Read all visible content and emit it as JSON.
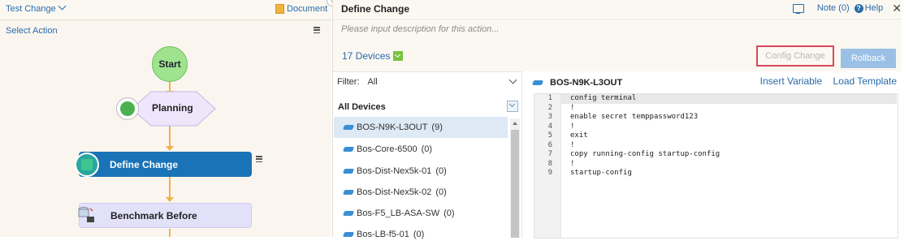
{
  "left_panel": {
    "title": "Test Change",
    "document_link": "Document",
    "select_action": "Select Action",
    "flow": {
      "start": "Start",
      "planning": "Planning",
      "define_change": "Define Change",
      "benchmark_before": "Benchmark Before"
    }
  },
  "right_panel": {
    "title": "Define Change",
    "note": "Note (0)",
    "help": "Help",
    "description_placeholder": "Please input description for this action...",
    "device_count": "17 Devices",
    "config_change_button": "Config Change",
    "rollback_button": "Rollback"
  },
  "device_list": {
    "filter_label": "Filter:",
    "filter_value": "All",
    "header": "All Devices",
    "devices": [
      {
        "name": "BOS-N9K-L3OUT",
        "count": "(9)",
        "selected": true
      },
      {
        "name": "Bos-Core-6500",
        "count": "(0)"
      },
      {
        "name": "Bos-Dist-Nex5k-01",
        "count": "(0)"
      },
      {
        "name": "Bos-Dist-Nex5k-02",
        "count": "(0)"
      },
      {
        "name": "Bos-F5_LB-ASA-SW",
        "count": "(0)"
      },
      {
        "name": "Bos-LB-f5-01",
        "count": "(0)"
      }
    ]
  },
  "editor": {
    "device": "BOS-N9K-L3OUT",
    "insert_variable": "Insert Variable",
    "load_template": "Load Template",
    "lines": [
      {
        "n": "1",
        "text": "config terminal"
      },
      {
        "n": "2",
        "text": "!"
      },
      {
        "n": "3",
        "text": "enable secret temppassword123"
      },
      {
        "n": "4",
        "text": "!"
      },
      {
        "n": "5",
        "text": "exit"
      },
      {
        "n": "6",
        "text": "!"
      },
      {
        "n": "7",
        "text": "copy running-config startup-config"
      },
      {
        "n": "8",
        "text": "!"
      },
      {
        "n": "9",
        "text": "startup-config"
      }
    ]
  },
  "colors": {
    "accent_blue": "#2a6aa8",
    "selected_node": "#1a73b6",
    "start_green": "#9fe38e",
    "connector": "#f0b04a",
    "highlight_red": "#d9485a"
  }
}
